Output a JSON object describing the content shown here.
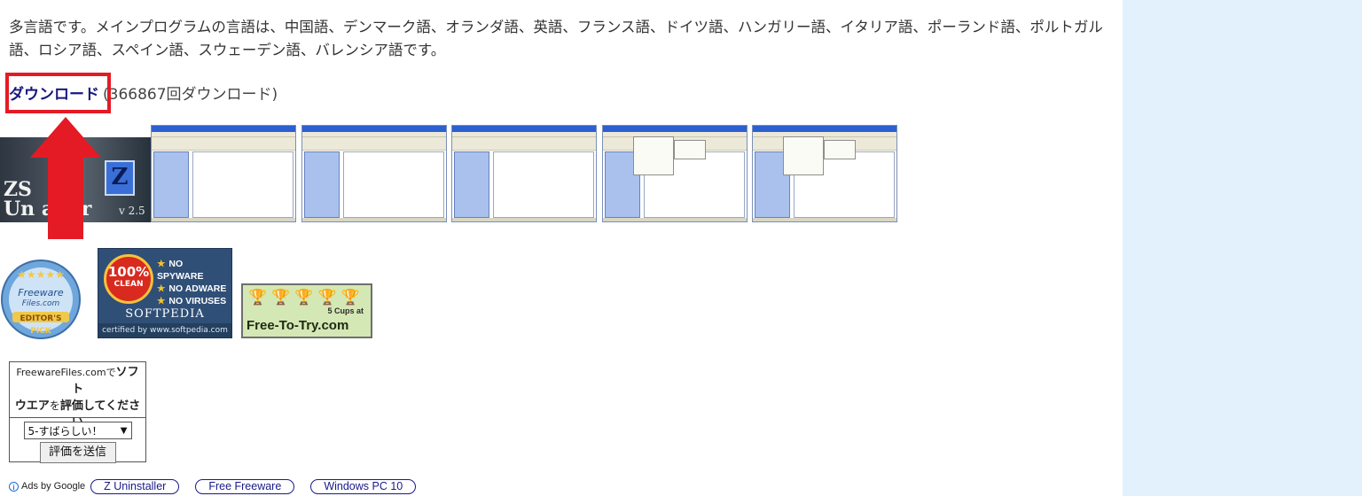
{
  "intro_text": "多言語です。メインプログラムの言語は、中国語、デンマーク語、オランダ語、英語、フランス語、ドイツ語、ハンガリー語、イタリア語、ポーランド語、ポルトガル語、ロシア語、スペイン語、スウェーデン語、バレンシア語です。",
  "download": {
    "link_label": "ダウンロード",
    "count_text": "(366867回ダウンロード)"
  },
  "highlight_color": "#e41b25",
  "splash": {
    "product_line1": "ZS",
    "product_line2": "Un  aller",
    "logo_letter": "Z",
    "version": "v 2.5"
  },
  "screenshots_count": 5,
  "badges": {
    "freeware": {
      "line1": "Freeware",
      "line2": "Files.com",
      "line3": "EDITOR'S",
      "line4": "PICK"
    },
    "softpedia": {
      "percent": "100%",
      "clean": "CLEAN",
      "items": [
        "NO SPYWARE",
        "NO ADWARE",
        "NO VIRUSES"
      ],
      "name": "SOFTPEDIA",
      "certified": "certified by www.softpedia.com"
    },
    "free_to_try": {
      "sub_line1": "5 Cups at",
      "name": "Free-To-Try.com"
    }
  },
  "rating": {
    "site": "FreewareFiles.comで",
    "title_bold1": "ソフト",
    "title_bold2": "ウエア",
    "title_mid": "を",
    "title_bold3": "評価してくださ",
    "title_bold4": "い",
    "selected": "5-すばらしい！",
    "submit": "評価を送信"
  },
  "ads": {
    "label": "Ads by Google",
    "items": [
      "Z Uninstaller",
      "Free Freeware",
      "Windows PC 10"
    ]
  }
}
